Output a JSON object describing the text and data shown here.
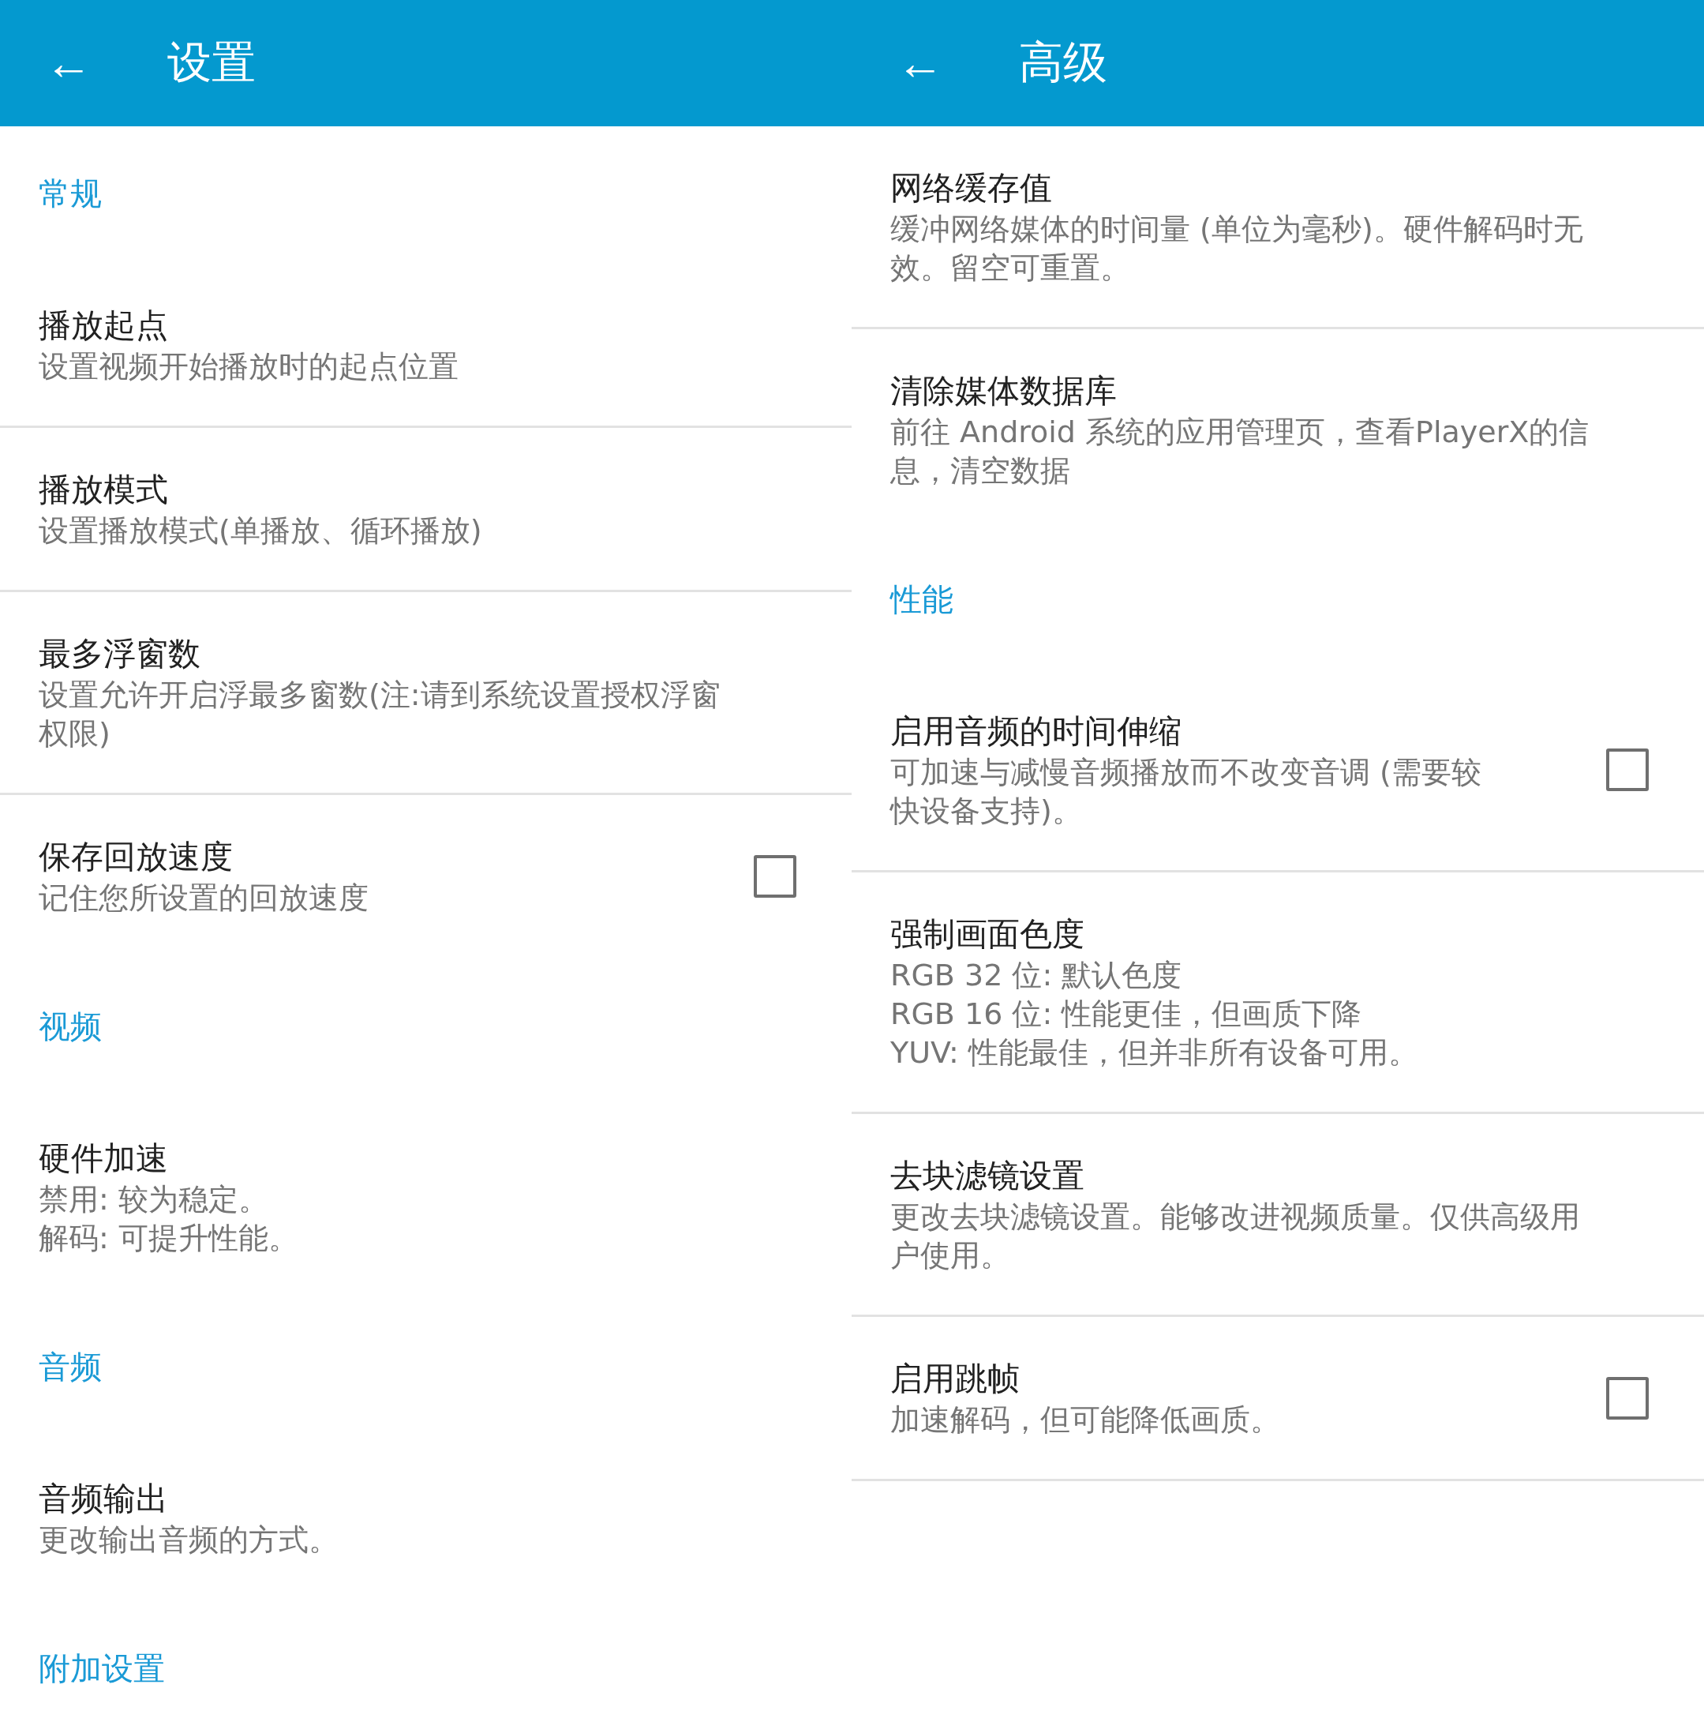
{
  "panels": [
    {
      "title": "设置",
      "back": "←",
      "items": [
        {
          "kind": "section",
          "label": "常规"
        },
        {
          "kind": "pref",
          "title": "播放起点",
          "summary": [
            "设置视频开始播放时的起点位置"
          ],
          "divider": true
        },
        {
          "kind": "pref",
          "title": "播放模式",
          "summary": [
            "设置播放模式(单播放、循环播放)"
          ],
          "divider": true
        },
        {
          "kind": "pref",
          "title": "最多浮窗数",
          "summary": [
            "设置允许开启浮最多窗数(注:请到系统设置授权浮窗",
            "权限)"
          ],
          "divider": true
        },
        {
          "kind": "check",
          "title": "保存回放速度",
          "summary": [
            "记住您所设置的回放速度"
          ],
          "checked": false,
          "divider": false
        },
        {
          "kind": "section",
          "label": "视频"
        },
        {
          "kind": "pref",
          "title": "硬件加速",
          "summary": [
            "禁用: 较为稳定。",
            "解码: 可提升性能。"
          ],
          "divider": false
        },
        {
          "kind": "section",
          "label": "音频"
        },
        {
          "kind": "pref",
          "title": "音频输出",
          "summary": [
            "更改输出音频的方式。"
          ],
          "divider": false
        },
        {
          "kind": "section",
          "label": "附加设置"
        }
      ]
    },
    {
      "title": "高级",
      "back": "←",
      "items": [
        {
          "kind": "pref",
          "title": "网络缓存值",
          "summary": [
            "缓冲网络媒体的时间量 (单位为毫秒)。硬件解码时无",
            "效。留空可重置。"
          ],
          "divider": true
        },
        {
          "kind": "pref",
          "title": "清除媒体数据库",
          "summary": [
            "前往 Android 系统的应用管理页，查看PlayerX的信",
            "息，清空数据"
          ],
          "divider": false
        },
        {
          "kind": "section",
          "label": "性能"
        },
        {
          "kind": "check",
          "title": "启用音频的时间伸缩",
          "summary": [
            "可加速与减慢音频播放而不改变音调 (需要较",
            "快设备支持)。"
          ],
          "checked": false,
          "divider": true
        },
        {
          "kind": "pref",
          "title": "强制画面色度",
          "summary": [
            "RGB 32 位: 默认色度",
            "RGB 16 位: 性能更佳，但画质下降",
            "YUV: 性能最佳，但并非所有设备可用。"
          ],
          "divider": true
        },
        {
          "kind": "pref",
          "title": "去块滤镜设置",
          "summary": [
            "更改去块滤镜设置。能够改进视频质量。仅供高级用",
            "户使用。"
          ],
          "divider": true
        },
        {
          "kind": "check",
          "title": "启用跳帧",
          "summary": [
            "加速解码，但可能降低画质。"
          ],
          "checked": false,
          "divider": true
        }
      ]
    }
  ]
}
